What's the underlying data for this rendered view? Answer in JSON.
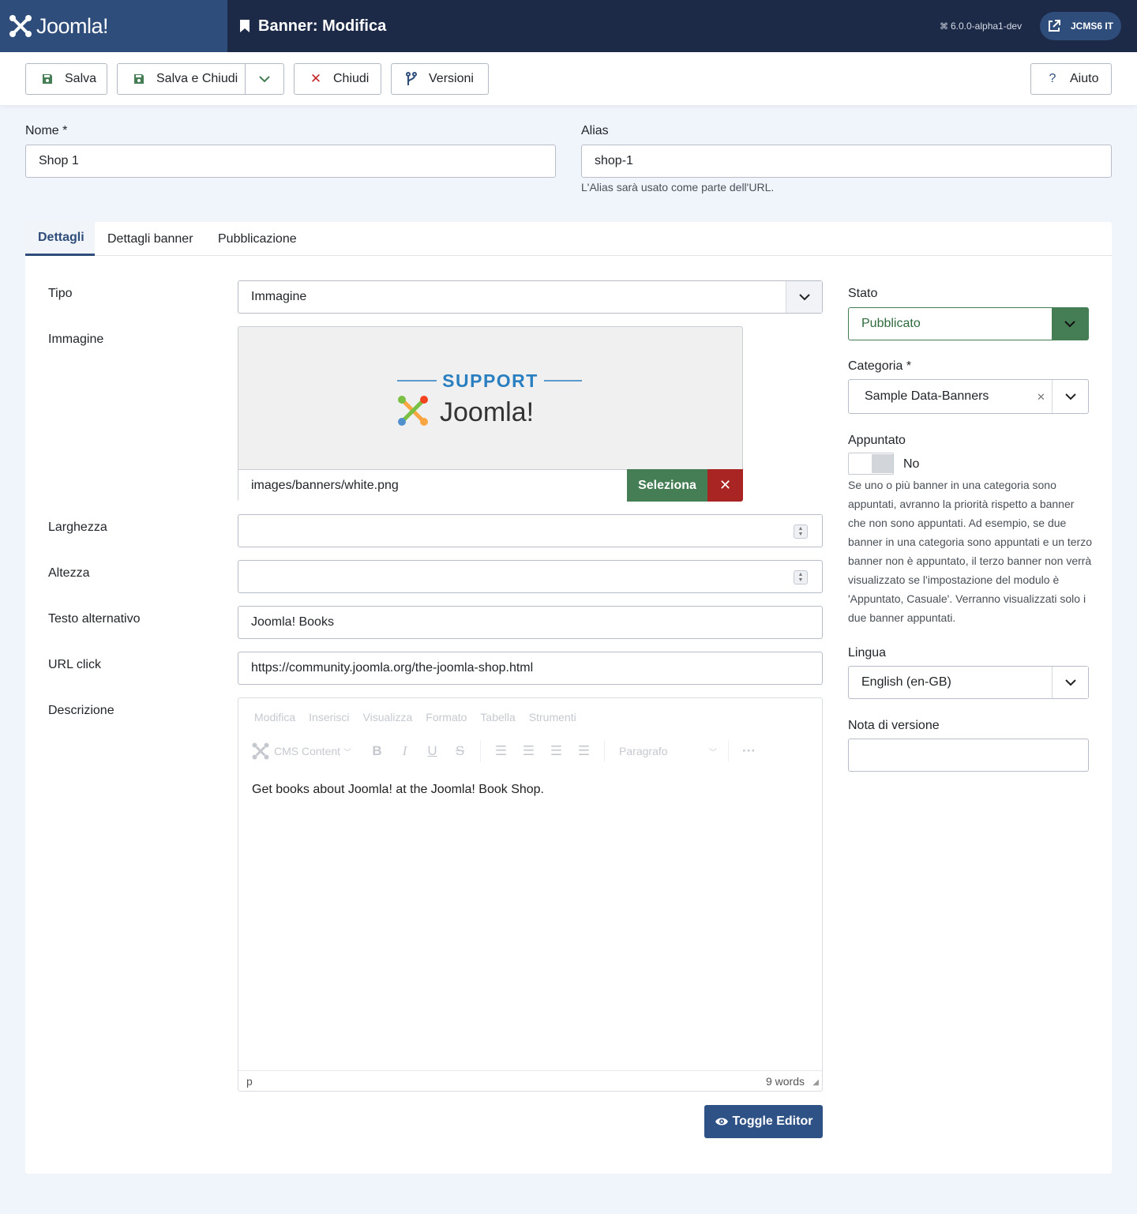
{
  "header": {
    "brand": "Joomla!",
    "page_title": "Banner: Modifica",
    "version": "6.0.0-alpha1-dev",
    "site_button": "JCMS6 IT"
  },
  "toolbar": {
    "save": "Salva",
    "save_close": "Salva e Chiudi",
    "close": "Chiudi",
    "versions": "Versioni",
    "help": "Aiuto"
  },
  "title_fields": {
    "name_label": "Nome *",
    "name_value": "Shop 1",
    "alias_label": "Alias",
    "alias_value": "shop-1",
    "alias_hint": "L'Alias sarà usato come parte dell'URL."
  },
  "tabs": [
    "Dettagli",
    "Dettagli banner",
    "Pubblicazione"
  ],
  "details": {
    "type_label": "Tipo",
    "type_value": "Immagine",
    "image_label": "Immagine",
    "image_preview_heading": "SUPPORT",
    "image_preview_brand": "Joomla!",
    "image_path": "images/banners/white.png",
    "image_select": "Seleziona",
    "width_label": "Larghezza",
    "width_value": "",
    "height_label": "Altezza",
    "height_value": "",
    "alt_label": "Testo alternativo",
    "alt_value": "Joomla! Books",
    "url_label": "URL click",
    "url_value": "https://community.joomla.org/the-joomla-shop.html",
    "desc_label": "Descrizione"
  },
  "editor": {
    "menu": [
      "Modifica",
      "Inserisci",
      "Visualizza",
      "Formato",
      "Tabella",
      "Strumenti"
    ],
    "cms_content": "CMS Content",
    "format_select": "Paragrafo",
    "content": "Get books about Joomla! at the Joomla! Book Shop.",
    "path": "p",
    "word_count": "9 words",
    "toggle": "Toggle Editor"
  },
  "sidebar": {
    "status_label": "Stato",
    "status_value": "Pubblicato",
    "category_label": "Categoria *",
    "category_value": "Sample Data-Banners",
    "pinned_label": "Appuntato",
    "pinned_value": "No",
    "pinned_help": "Se uno o più banner in una categoria sono appuntati, avranno la priorità rispetto a banner che non sono appuntati. Ad esempio, se due banner in una categoria sono appuntati e un terzo banner non è appuntato, il terzo banner non verrà visualizzato se l'impostazione del modulo è 'Appuntato, Casuale'. Verranno visualizzati solo i due banner appuntati.",
    "language_label": "Lingua",
    "language_value": "English (en-GB)",
    "version_note_label": "Nota di versione",
    "version_note_value": ""
  },
  "colors": {
    "header_bg": "#1c2a47",
    "logo_bg": "#2f4d7a",
    "success": "#457d54",
    "danger": "#a82524",
    "primary": "#2f5286"
  }
}
